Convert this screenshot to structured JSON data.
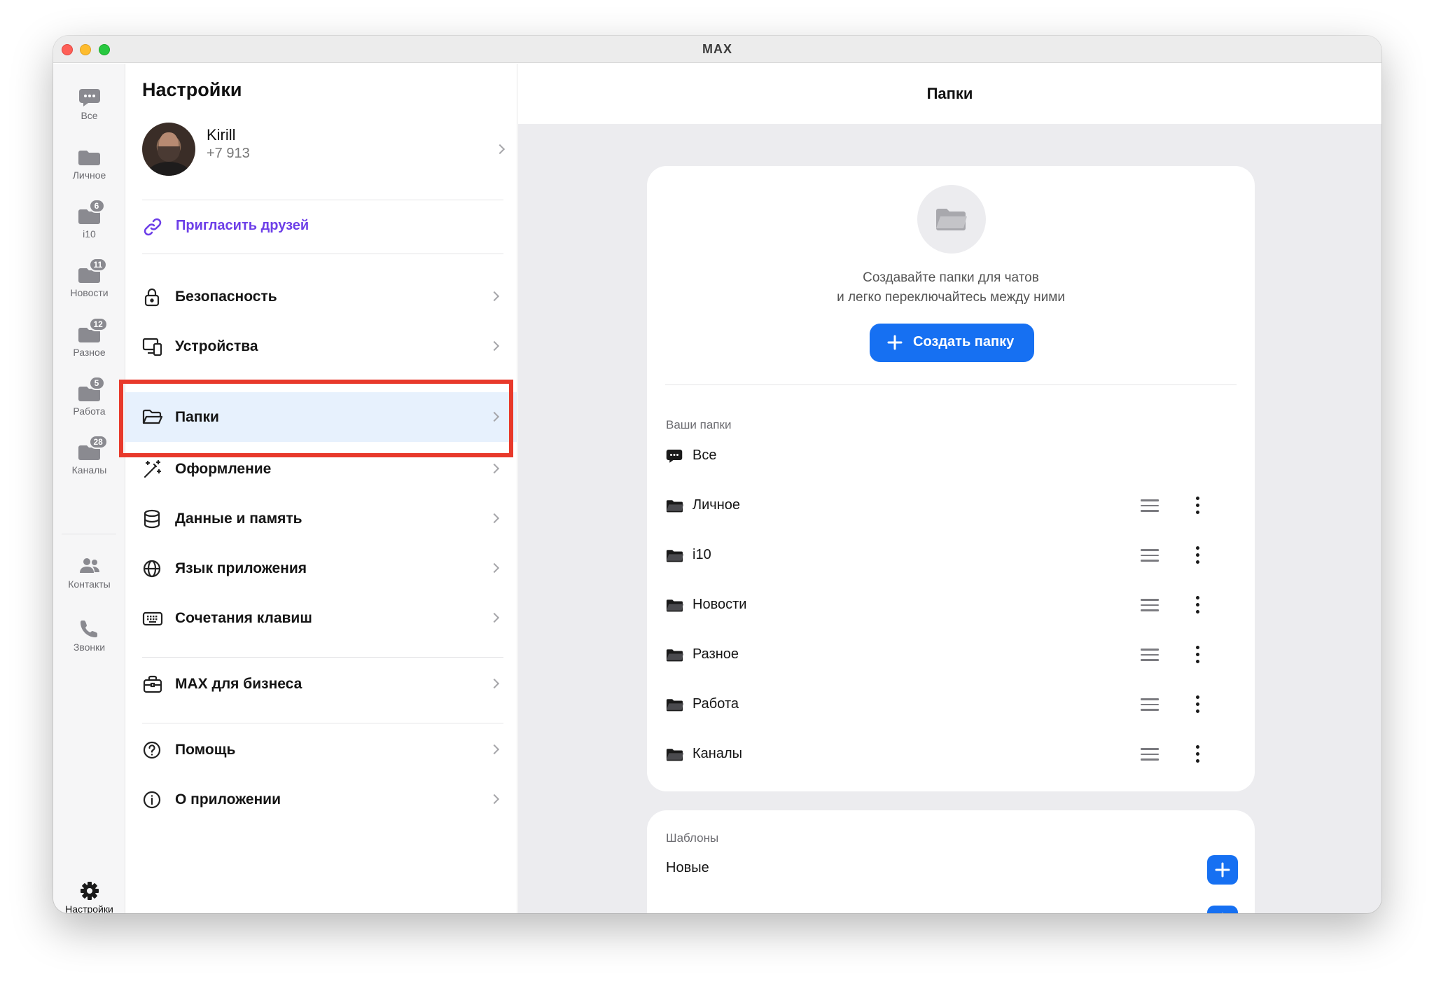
{
  "window": {
    "title": "MAX"
  },
  "rail": {
    "items": [
      {
        "label": "Все",
        "badge": null
      },
      {
        "label": "Личное",
        "badge": null
      },
      {
        "label": "i10",
        "badge": "6"
      },
      {
        "label": "Новости",
        "badge": "11"
      },
      {
        "label": "Разное",
        "badge": "12"
      },
      {
        "label": "Работа",
        "badge": "5"
      },
      {
        "label": "Каналы",
        "badge": "28"
      }
    ],
    "contacts_label": "Контакты",
    "calls_label": "Звонки",
    "settings_label": "Настройки"
  },
  "settings": {
    "title": "Настройки",
    "profile": {
      "name": "Kirill",
      "phone": "+7 913"
    },
    "invite_label": "Пригласить друзей",
    "menu": [
      {
        "label": "Безопасность",
        "icon": "lock-icon"
      },
      {
        "label": "Устройства",
        "icon": "devices-icon"
      },
      {
        "label": "Папки",
        "icon": "folder-open-icon",
        "active": true
      },
      {
        "label": "Оформление",
        "icon": "magic-wand-icon"
      },
      {
        "label": "Данные и память",
        "icon": "database-icon"
      },
      {
        "label": "Язык приложения",
        "icon": "globe-icon"
      },
      {
        "label": "Сочетания клавиш",
        "icon": "keyboard-icon"
      },
      {
        "label": "MAX для бизнеса",
        "icon": "briefcase-icon"
      },
      {
        "label": "Помощь",
        "icon": "help-icon"
      },
      {
        "label": "О приложении",
        "icon": "info-icon"
      }
    ]
  },
  "folders_panel": {
    "title": "Папки",
    "empty_text_line1": "Создавайте папки для чатов",
    "empty_text_line2": "и легко переключайтесь между ними",
    "create_button": "Создать папку",
    "your_folders_label": "Ваши папки",
    "folders": [
      "Все",
      "Личное",
      "i10",
      "Новости",
      "Разное",
      "Работа",
      "Каналы"
    ],
    "templates_label": "Шаблоны",
    "templates": [
      "Новые"
    ]
  },
  "colors": {
    "accent": "#1670f2",
    "invite": "#6d3fe8",
    "highlight": "#e8392b",
    "active_row": "#e7f1fd"
  }
}
